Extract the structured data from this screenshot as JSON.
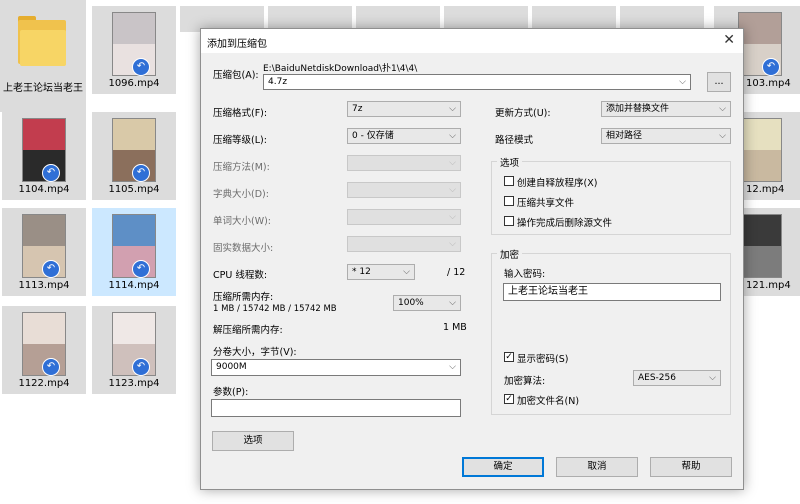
{
  "explorer": {
    "folder": {
      "label": "上老王论坛当老王"
    },
    "files": [
      {
        "label": "1096.mp4"
      },
      {
        "label": "103.mp4"
      },
      {
        "label": "1104.mp4"
      },
      {
        "label": "1105.mp4"
      },
      {
        "label": "12.mp4"
      },
      {
        "label": "1113.mp4"
      },
      {
        "label": "1114.mp4"
      },
      {
        "label": "121.mp4"
      },
      {
        "label": "1122.mp4"
      },
      {
        "label": "1123.mp4"
      }
    ]
  },
  "dialog": {
    "title": "添加到压缩包",
    "close_glyph": "✕",
    "archive": {
      "label": "压缩包(A):",
      "path": "E:\\BaiduNetdiskDownload\\扑1\\4\\4\\",
      "name_value": "4.7z",
      "browse_label": "..."
    },
    "left": {
      "format": {
        "label": "压缩格式(F):",
        "value": "7z"
      },
      "level": {
        "label": "压缩等级(L):",
        "value": "0 - 仅存储"
      },
      "method": {
        "label": "压缩方法(M):"
      },
      "dict": {
        "label": "字典大小(D):"
      },
      "word": {
        "label": "单词大小(W):"
      },
      "solid": {
        "label": "固实数据大小:"
      },
      "threads": {
        "label": "CPU 线程数:",
        "value": "* 12",
        "max": "/ 12"
      },
      "mem_compress": {
        "label": "压缩所需内存:",
        "detail": "1 MB / 15742 MB / 15742 MB",
        "percent": "100%"
      },
      "mem_decompress": {
        "label": "解压缩所需内存:",
        "value": "1 MB"
      },
      "volume": {
        "label": "分卷大小，字节(V):",
        "value": "9000M"
      },
      "params": {
        "label": "参数(P):",
        "value": ""
      },
      "options_button": "选项"
    },
    "right": {
      "update": {
        "label": "更新方式(U):",
        "value": "添加并替换文件"
      },
      "path_mode": {
        "label": "路径模式",
        "value": "相对路径"
      },
      "options_group": {
        "title": "选项",
        "items": [
          {
            "label": "创建自释放程序(X)",
            "checked": false
          },
          {
            "label": "压缩共享文件",
            "checked": false
          },
          {
            "label": "操作完成后删除源文件",
            "checked": false
          }
        ]
      },
      "encryption": {
        "title": "加密",
        "password_label": "输入密码:",
        "password_value": "上老王论坛当老王",
        "show_password": {
          "label": "显示密码(S)",
          "checked": true
        },
        "method_label": "加密算法:",
        "method_value": "AES-256",
        "encrypt_names": {
          "label": "加密文件名(N)",
          "checked": true
        }
      }
    },
    "buttons": {
      "ok": "确定",
      "cancel": "取消",
      "help": "帮助"
    },
    "check_glyph": "✓",
    "arrow_glyph": "⌵"
  }
}
